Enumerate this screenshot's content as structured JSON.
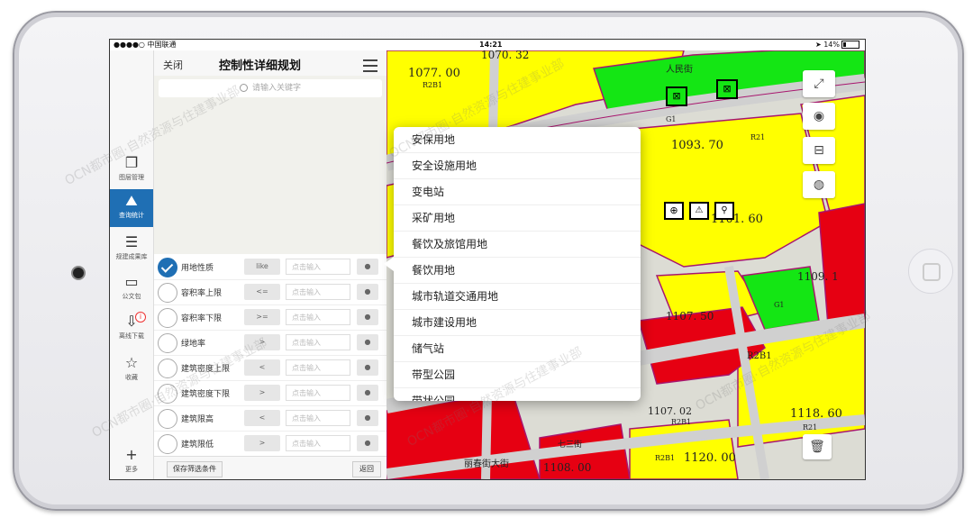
{
  "status": {
    "carrier": "●●●●○ 中国联通 ",
    "time": "14:21",
    "battery": "14%"
  },
  "rail": {
    "items": [
      {
        "label": "图层管理",
        "icon": "layers-icon"
      },
      {
        "label": "查询统计",
        "icon": "query-stats-icon"
      },
      {
        "label": "规建成果库",
        "icon": "archive-icon"
      },
      {
        "label": "公文包",
        "icon": "folder-icon"
      },
      {
        "label": "离线下载",
        "icon": "download-icon"
      },
      {
        "label": "收藏",
        "icon": "star-icon"
      }
    ],
    "more": "更多",
    "badge": "i"
  },
  "panel": {
    "close": "关闭",
    "title": "控制性详细规划",
    "search_placeholder": "请输入关键字",
    "rows": [
      {
        "field": "用地性质",
        "op": "like",
        "value": "点击输入",
        "checked": true
      },
      {
        "field": "容积率上限",
        "op": "<=",
        "value": "点击输入",
        "checked": false
      },
      {
        "field": "容积率下限",
        "op": ">=",
        "value": "点击输入",
        "checked": false
      },
      {
        "field": "绿地率",
        "op": ">",
        "value": "点击输入",
        "checked": false
      },
      {
        "field": "建筑密度上限",
        "op": "<",
        "value": "点击输入",
        "checked": false
      },
      {
        "field": "建筑密度下限",
        "op": ">",
        "value": "点击输入",
        "checked": false
      },
      {
        "field": "建筑限高",
        "op": "<",
        "value": "点击输入",
        "checked": false
      },
      {
        "field": "建筑限低",
        "op": ">",
        "value": "点击输入",
        "checked": false
      }
    ],
    "dot": "●",
    "save": "保存筛选条件",
    "back": "返回"
  },
  "dropdown": {
    "options": [
      "安保用地",
      "安全设施用地",
      "变电站",
      "采矿用地",
      "餐饮及旅馆用地",
      "餐饮用地",
      "城市轨道交通用地",
      "城市建设用地",
      "储气站",
      "带型公园",
      "带状公园"
    ]
  },
  "map": {
    "labels": {
      "l1": "1077. 00",
      "l2": "R2B1",
      "l3": "1093. 70",
      "l4": "R21",
      "l5": "1101. 60",
      "l6": "1107. 50",
      "l7": "G1",
      "l8": "1118. 60",
      "l9": "R21",
      "l10": "1120. 00",
      "l11": "R2B1",
      "l12": "1108. 00",
      "l13": "1070. 32",
      "l14": "G1",
      "l15": "1109. 1",
      "l16": "R2B1",
      "l17": "1107. 02",
      "l18": "R2B1"
    },
    "roads": {
      "r1": "人民街",
      "r2": "七三街",
      "r3": "丽春街大街"
    },
    "colors": {
      "yellow": "#ffff00",
      "red": "#e60012",
      "green": "#14e614",
      "road": "#d8d8d8",
      "boundary": "#a8156e"
    }
  },
  "watermark": "OCN都市圈·自然资源与住建事业部"
}
